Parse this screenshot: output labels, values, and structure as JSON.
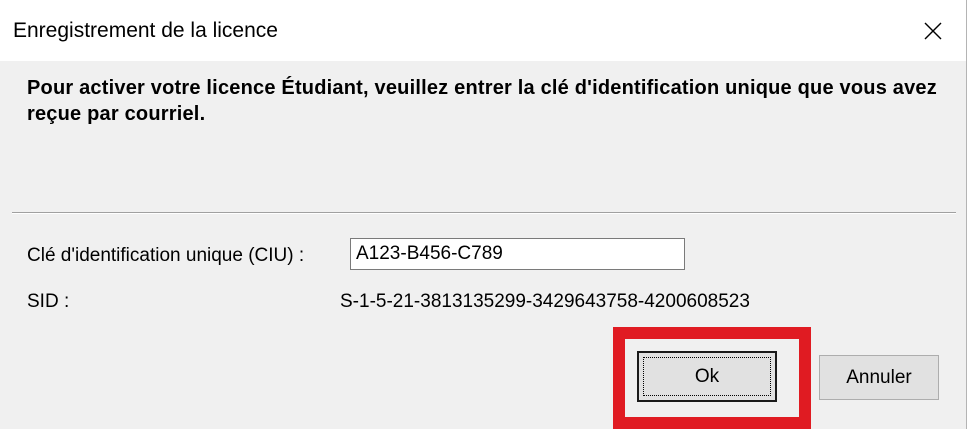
{
  "window": {
    "title": "Enregistrement de la licence",
    "close_icon": "close-icon"
  },
  "form": {
    "instructions": "Pour activer votre licence Étudiant, veuillez entrer la clé d'identification unique que vous avez reçue par courriel.",
    "ciu_label": "Clé d'identification unique (CIU) :",
    "ciu_value": "A123-B456-C789",
    "sid_label": "SID :",
    "sid_value": "S-1-5-21-3813135299-3429643758-4200608523"
  },
  "buttons": {
    "ok_label": "Ok",
    "cancel_label": "Annuler"
  },
  "colors": {
    "highlight": "#e01b22",
    "background": "#f0f0f0"
  }
}
